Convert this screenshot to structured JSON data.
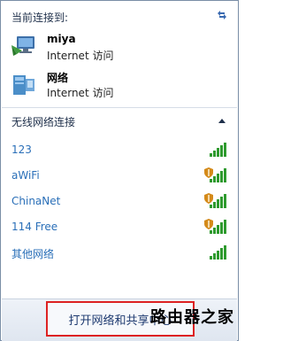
{
  "header": {
    "title": "当前连接到:"
  },
  "connections": [
    {
      "name": "miya",
      "status": "Internet 访问",
      "icon": "network-monitor-icon"
    },
    {
      "name": "网络",
      "status": "Internet 访问",
      "icon": "network-computer-icon"
    }
  ],
  "wireless": {
    "header": "无线网络连接",
    "networks": [
      {
        "label": "123",
        "secured": false
      },
      {
        "label": "aWiFi",
        "secured": true
      },
      {
        "label": "ChinaNet",
        "secured": true
      },
      {
        "label": "114 Free",
        "secured": true
      },
      {
        "label": "其他网络",
        "secured": false
      }
    ]
  },
  "footer": {
    "button_label": "打开网络和共享中心",
    "watermark": "路由器之家"
  },
  "colors": {
    "link": "#2a6fb8",
    "signal": "#2e9a2e",
    "shield": "#d48a1a",
    "highlight_border": "#d22"
  }
}
